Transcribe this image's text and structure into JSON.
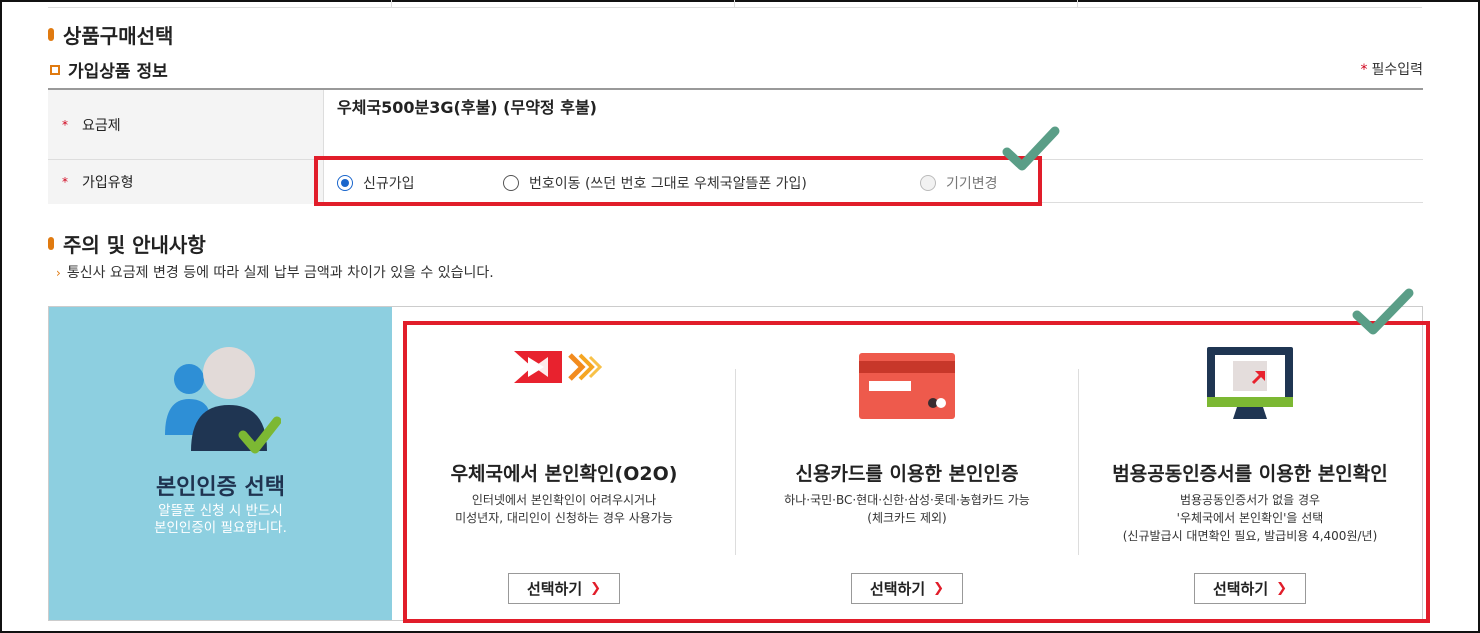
{
  "sections": {
    "product_selection": "상품구매선택",
    "notice": "주의 및 안내사항"
  },
  "subscription": {
    "subtitle": "가입상품 정보",
    "required_note": "필수입력",
    "required_mark": "*",
    "rate_plan_label": "요금제",
    "rate_plan_value": "우체국500분3G(후불) (무약정 후불)",
    "join_type_label": "가입유형",
    "join_types": [
      {
        "label": "신규가입",
        "checked": true,
        "disabled": false
      },
      {
        "label": "번호이동 (쓰던 번호 그대로 우체국알뜰폰 가입)",
        "checked": false,
        "disabled": false
      },
      {
        "label": "기기변경",
        "checked": false,
        "disabled": true
      }
    ]
  },
  "notice_text": "통신사 요금제 변경 등에 따라 실제 납부 금액과 차이가 있을 수 있습니다.",
  "auth": {
    "panel_title": "본인인증 선택",
    "panel_desc_1": "알뜰폰 신청 시 반드시",
    "panel_desc_2": "본인인증이 필요합니다.",
    "options": [
      {
        "title": "우체국에서 본인확인(O2O)",
        "desc_1": "인터넷에서 본인확인이 어려우시거나",
        "desc_2": "미성년자, 대리인이 신청하는 경우 사용가능",
        "desc_3": "",
        "button": "선택하기",
        "icon": "post-office-logo-icon"
      },
      {
        "title": "신용카드를 이용한 본인인증",
        "desc_1": "하나·국민·BC·현대·신한·삼성·롯데·농협카드 가능",
        "desc_2": "(체크카드 제외)",
        "desc_3": "",
        "button": "선택하기",
        "icon": "credit-card-icon"
      },
      {
        "title": "범용공동인증서를 이용한 본인확인",
        "desc_1": "범용공동인증서가 없을 경우",
        "desc_2": "'우체국에서 본인확인'을 선택",
        "desc_3": "(신규발급시 대면확인 필요, 발급비용 4,400원/년)",
        "button": "선택하기",
        "icon": "monitor-certificate-icon"
      }
    ]
  },
  "colors": {
    "accent_orange": "#e07a10",
    "highlight_red": "#e11d2a",
    "check_green": "#5a9e87",
    "panel_blue": "#8dcfe0",
    "radio_blue": "#1a66cc"
  }
}
